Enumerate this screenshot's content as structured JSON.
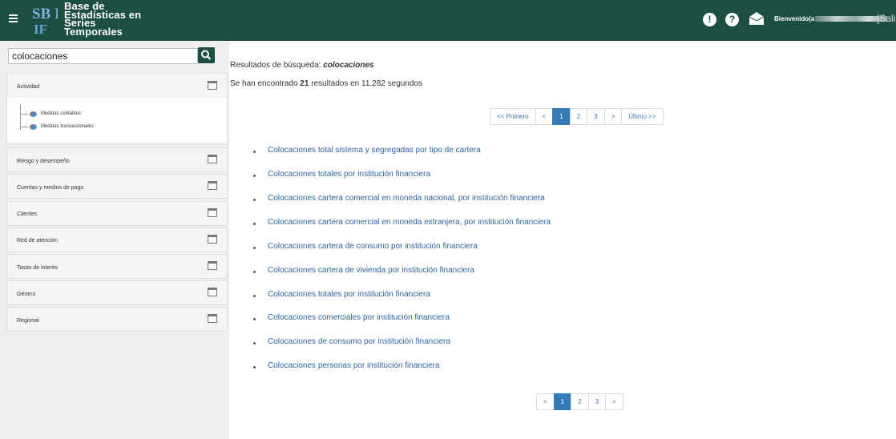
{
  "header": {
    "logo_mark": "SB IF",
    "logo_lines": [
      "Base de",
      "Estadísticas en",
      "Series",
      "Temporales"
    ],
    "welcome_label": "Bienvenido(a",
    "logout_label": "[Sali",
    "alert_icon": "!",
    "help_icon": "?"
  },
  "sidebar": {
    "search_value": "colocaciones",
    "sections": [
      {
        "label": "Actividad"
      },
      {
        "label": "Riesgo y desempeño"
      },
      {
        "label": "Cuentas y medios de pago"
      },
      {
        "label": "Clientes"
      },
      {
        "label": "Red de atención"
      },
      {
        "label": "Tasas de interés"
      },
      {
        "label": "Género"
      },
      {
        "label": "Regional"
      }
    ],
    "tree_items": [
      "Medidas contables",
      "Medidas transaccionales"
    ]
  },
  "main": {
    "title_prefix": "Resultados de búsqueda:",
    "title_term": "colocaciones",
    "count_prefix": "Se han encontrado",
    "count_value": "21",
    "count_suffix": "resultados en 11.282 segundos",
    "pager_top": [
      "<< Primero",
      "<",
      "1",
      "2",
      "3",
      ">",
      "Último >>"
    ],
    "pager_bottom": [
      "<",
      "1",
      "2",
      "3",
      ">"
    ],
    "results": [
      "Colocaciones total sistema y segregadas por tipo de cartera",
      "Colocaciones totales por institución financiera",
      "Colocaciones cartera comercial en moneda nacional, por institución financiera",
      "Colocaciones cartera comercial en moneda extranjera, por institución financiera",
      "Colocaciones cartera de consumo por institución financiera",
      "Colocaciones cartera de vivienda por institución financiera",
      "Colocaciones totales por institución financiera",
      "Colocaciones comerciales por institución financiera",
      "Colocaciones de consumo por institución financiera",
      "Colocaciones personas por institución financiera"
    ]
  },
  "colors": {
    "header_bg": "#1c4e43",
    "link": "#2a62a6",
    "pager_active": "#337ab7"
  }
}
